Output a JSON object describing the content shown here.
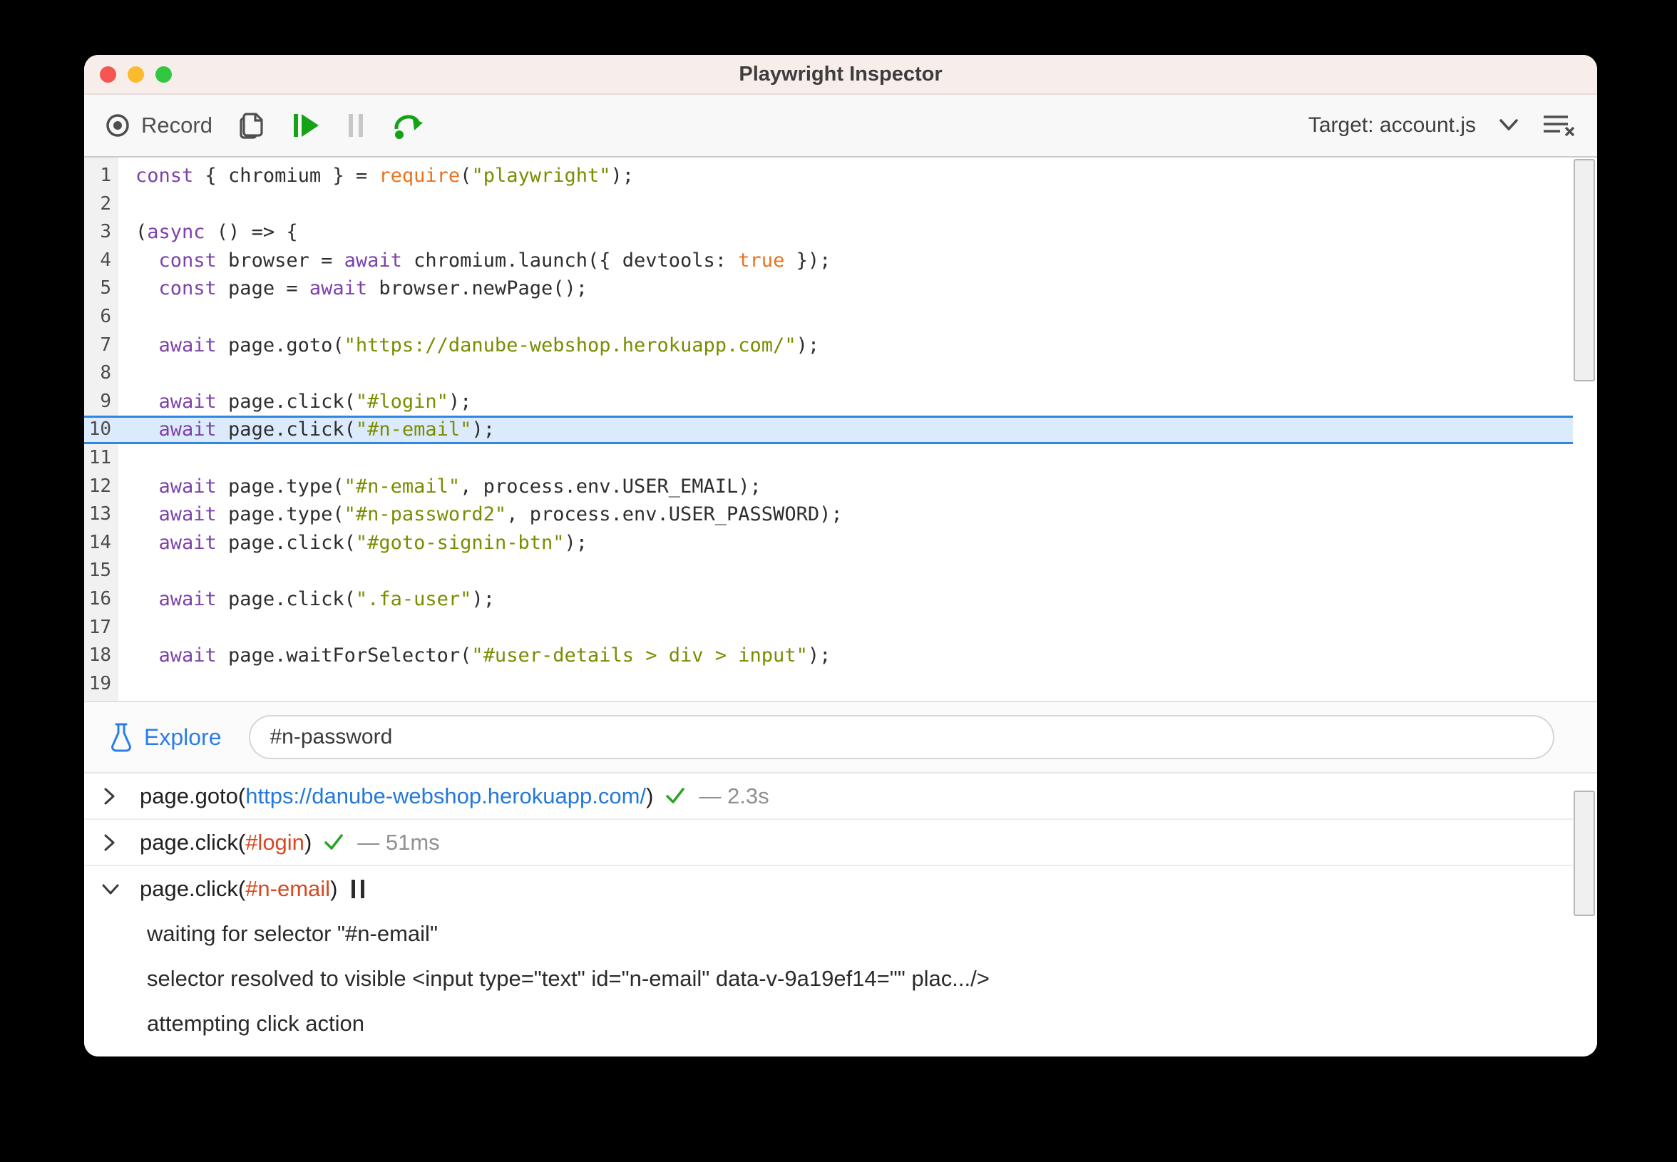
{
  "window": {
    "title": "Playwright Inspector"
  },
  "toolbar": {
    "record_label": "Record",
    "target_label": "Target:",
    "target_value": " account.js"
  },
  "explore": {
    "label": "Explore",
    "input_value": "#n-password"
  },
  "colors": {
    "keyword": "#7d41ab",
    "string": "#7b8c00",
    "atom_orange": "#ea731d",
    "highlight_bg": "#dcebfc",
    "highlight_border": "#2f87e2",
    "link_blue": "#2478d8",
    "selector_red": "#d9471f",
    "check_green": "#2aa327",
    "toolbar_green": "#16a216",
    "explore_blue": "#2b7de9"
  },
  "code": {
    "highlighted_line": 10,
    "lines": [
      {
        "n": 1,
        "tokens": [
          [
            "kw",
            "const"
          ],
          [
            "pl",
            " { chromium } = "
          ],
          [
            "or",
            "require"
          ],
          [
            "pl",
            "("
          ],
          [
            "str",
            "\"playwright\""
          ],
          [
            "pl",
            ");"
          ]
        ]
      },
      {
        "n": 2,
        "tokens": []
      },
      {
        "n": 3,
        "tokens": [
          [
            "pl",
            "("
          ],
          [
            "kw",
            "async"
          ],
          [
            "pl",
            " () => {"
          ]
        ]
      },
      {
        "n": 4,
        "tokens": [
          [
            "pl",
            "  "
          ],
          [
            "kw",
            "const"
          ],
          [
            "pl",
            " browser = "
          ],
          [
            "kw",
            "await"
          ],
          [
            "pl",
            " chromium.launch({ devtools: "
          ],
          [
            "or",
            "true"
          ],
          [
            "pl",
            " });"
          ]
        ]
      },
      {
        "n": 5,
        "tokens": [
          [
            "pl",
            "  "
          ],
          [
            "kw",
            "const"
          ],
          [
            "pl",
            " page = "
          ],
          [
            "kw",
            "await"
          ],
          [
            "pl",
            " browser.newPage();"
          ]
        ]
      },
      {
        "n": 6,
        "tokens": []
      },
      {
        "n": 7,
        "tokens": [
          [
            "pl",
            "  "
          ],
          [
            "kw",
            "await"
          ],
          [
            "pl",
            " page.goto("
          ],
          [
            "str",
            "\"https://danube-webshop.herokuapp.com/\""
          ],
          [
            "pl",
            ");"
          ]
        ]
      },
      {
        "n": 8,
        "tokens": []
      },
      {
        "n": 9,
        "tokens": [
          [
            "pl",
            "  "
          ],
          [
            "kw",
            "await"
          ],
          [
            "pl",
            " page.click("
          ],
          [
            "str",
            "\"#login\""
          ],
          [
            "pl",
            ");"
          ]
        ]
      },
      {
        "n": 10,
        "tokens": [
          [
            "pl",
            "  "
          ],
          [
            "kw",
            "await"
          ],
          [
            "pl",
            " page.click("
          ],
          [
            "str",
            "\"#n-email\""
          ],
          [
            "pl",
            ");"
          ]
        ]
      },
      {
        "n": 11,
        "tokens": []
      },
      {
        "n": 12,
        "tokens": [
          [
            "pl",
            "  "
          ],
          [
            "kw",
            "await"
          ],
          [
            "pl",
            " page.type("
          ],
          [
            "str",
            "\"#n-email\""
          ],
          [
            "pl",
            ", process.env.USER_EMAIL);"
          ]
        ]
      },
      {
        "n": 13,
        "tokens": [
          [
            "pl",
            "  "
          ],
          [
            "kw",
            "await"
          ],
          [
            "pl",
            " page.type("
          ],
          [
            "str",
            "\"#n-password2\""
          ],
          [
            "pl",
            ", process.env.USER_PASSWORD);"
          ]
        ]
      },
      {
        "n": 14,
        "tokens": [
          [
            "pl",
            "  "
          ],
          [
            "kw",
            "await"
          ],
          [
            "pl",
            " page.click("
          ],
          [
            "str",
            "\"#goto-signin-btn\""
          ],
          [
            "pl",
            ");"
          ]
        ]
      },
      {
        "n": 15,
        "tokens": []
      },
      {
        "n": 16,
        "tokens": [
          [
            "pl",
            "  "
          ],
          [
            "kw",
            "await"
          ],
          [
            "pl",
            " page.click("
          ],
          [
            "str",
            "\".fa-user\""
          ],
          [
            "pl",
            ");"
          ]
        ]
      },
      {
        "n": 17,
        "tokens": []
      },
      {
        "n": 18,
        "tokens": [
          [
            "pl",
            "  "
          ],
          [
            "kw",
            "await"
          ],
          [
            "pl",
            " page.waitForSelector("
          ],
          [
            "str",
            "\"#user-details > div > input\""
          ],
          [
            "pl",
            ");"
          ]
        ]
      },
      {
        "n": 19,
        "tokens": []
      }
    ]
  },
  "log": {
    "entries": [
      {
        "expanded": false,
        "method": "page.goto(",
        "arg": "https://danube-webshop.herokuapp.com/",
        "arg_style": "link",
        "close": ")",
        "status": "done",
        "duration": "— 2.3s",
        "details": []
      },
      {
        "expanded": false,
        "method": "page.click(",
        "arg": "#login",
        "arg_style": "selector",
        "close": ")",
        "status": "done",
        "duration": "— 51ms",
        "details": []
      },
      {
        "expanded": true,
        "method": "page.click(",
        "arg": "#n-email",
        "arg_style": "selector",
        "close": ")",
        "status": "running",
        "duration": "",
        "details": [
          "waiting for selector \"#n-email\"",
          "selector resolved to visible <input type=\"text\" id=\"n-email\" data-v-9a19ef14=\"\" plac.../>",
          "attempting click action"
        ]
      }
    ]
  }
}
